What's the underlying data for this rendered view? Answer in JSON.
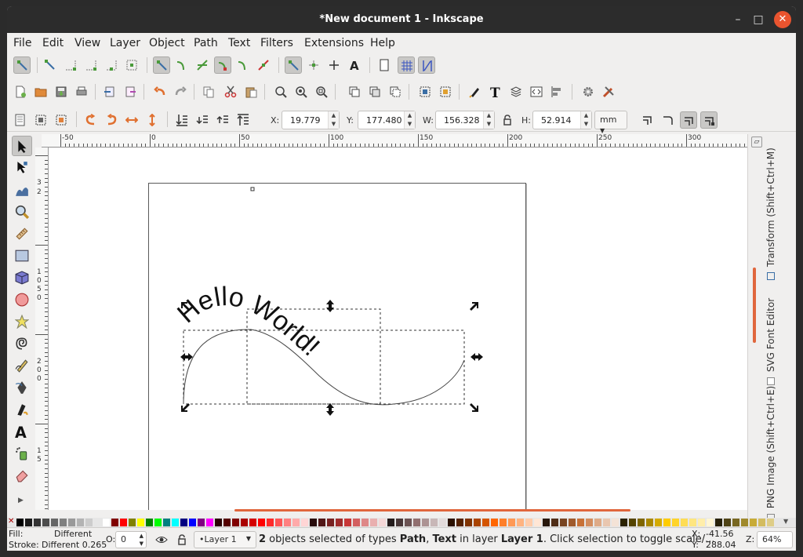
{
  "window": {
    "title": "*New document 1 - Inkscape"
  },
  "menu": [
    "File",
    "Edit",
    "View",
    "Layer",
    "Object",
    "Path",
    "Text",
    "Filters",
    "Extensions",
    "Help"
  ],
  "selector_bar": {
    "x_label": "X:",
    "x_value": "19.779",
    "y_label": "Y:",
    "y_value": "177.480",
    "w_label": "W:",
    "w_value": "156.328",
    "h_label": "H:",
    "h_value": "52.914",
    "unit": "mm"
  },
  "ruler": {
    "h_labels": [
      "-50",
      "0",
      "50",
      "100",
      "150",
      "200",
      "250",
      "300"
    ],
    "v_labels": [
      "3",
      "2",
      "1",
      "0",
      "5",
      "0",
      "2",
      "0",
      "0",
      "1",
      "5"
    ]
  },
  "canvas": {
    "text_on_path": "Hello World!",
    "text_color": "#111111",
    "path_color": "#444444"
  },
  "dock": {
    "tabs": [
      "Transform (Shift+Ctrl+M)",
      "SVG Font Editor",
      "PNG Image (Shift+Ctrl+E)"
    ]
  },
  "palette": {
    "colors": [
      "#000000",
      "#1a1a1a",
      "#333333",
      "#4d4d4d",
      "#666666",
      "#808080",
      "#999999",
      "#b3b3b3",
      "#cccccc",
      "#e6e6e6",
      "#ffffff",
      "#800000",
      "#ff0000",
      "#808000",
      "#ffff00",
      "#008000",
      "#00ff00",
      "#008080",
      "#00ffff",
      "#000080",
      "#0000ff",
      "#800080",
      "#ff00ff",
      "#2b0000",
      "#550000",
      "#800000",
      "#aa0000",
      "#d40000",
      "#ff0000",
      "#ff2a2a",
      "#ff5555",
      "#ff8080",
      "#ffaaaa",
      "#ffd5d5",
      "#280b0b",
      "#501616",
      "#782121",
      "#a02c2c",
      "#c83737",
      "#d35f5f",
      "#de8787",
      "#e9afaf",
      "#f4d7d7",
      "#241c1c",
      "#483737",
      "#6c5353",
      "#916f6f",
      "#ac9393",
      "#c8b7b7",
      "#e3dbdb",
      "#2b1100",
      "#552200",
      "#803300",
      "#aa4400",
      "#d45500",
      "#ff6600",
      "#ff7f2a",
      "#ff9955",
      "#ffb380",
      "#ffccaa",
      "#ffe6d5",
      "#28170b",
      "#502d16",
      "#784421",
      "#a05a2c",
      "#c87137",
      "#d38d5f",
      "#deaa87",
      "#e9c6af",
      "#f4e3d7",
      "#2b2200",
      "#554400",
      "#806600",
      "#aa8800",
      "#d4aa00",
      "#ffcc00",
      "#ffd42a",
      "#ffdd55",
      "#ffe680",
      "#ffeeaa",
      "#fff6d5",
      "#28220b",
      "#504416",
      "#786721",
      "#a0892c",
      "#c8ab37",
      "#d3bc5f",
      "#decd87"
    ]
  },
  "status": {
    "fill_label": "Fill:",
    "fill_value": "Different",
    "stroke_label": "Stroke:",
    "stroke_value": "Different 0.265",
    "opacity_label": "O:",
    "opacity_value": "0",
    "layer": "•Layer 1",
    "msg_count": "2",
    "msg_pre": " objects selected of types ",
    "msg_type1": "Path",
    "msg_sep": ", ",
    "msg_type2": "Text",
    "msg_mid": " in layer ",
    "msg_layer": "Layer 1",
    "msg_post": ". Click selection to toggle scale/...",
    "x_label": "X:",
    "x_value": "-41.56",
    "y_label": "Y:",
    "y_value": "288.04",
    "z_label": "Z:",
    "z_value": "64%"
  }
}
